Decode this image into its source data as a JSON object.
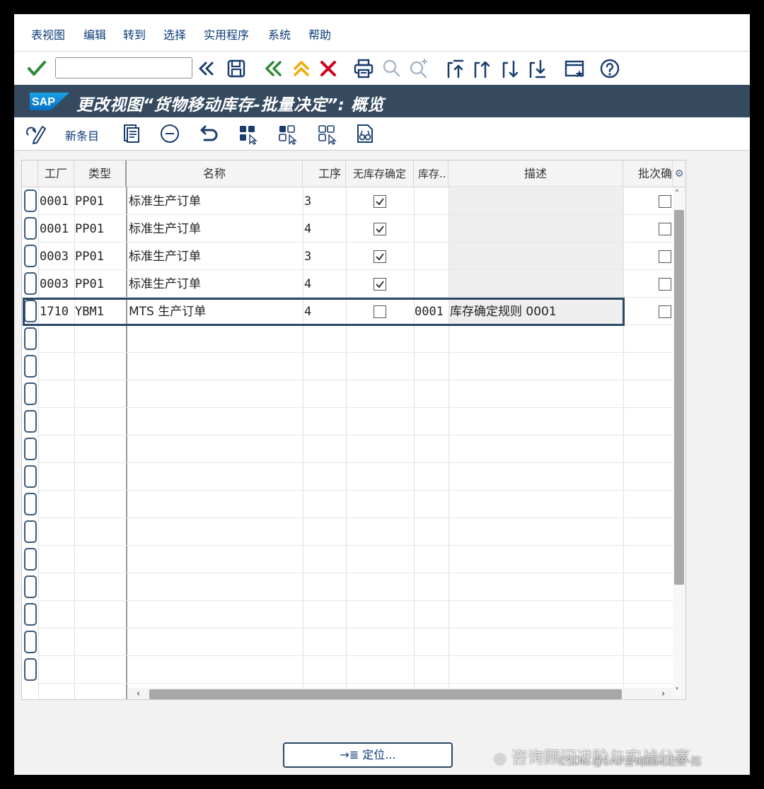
{
  "menu": [
    "表视图",
    "编辑",
    "转到",
    "选择",
    "实用程序",
    "系统",
    "帮助"
  ],
  "toolbar": {
    "command_value": "",
    "icons": [
      "enter-icon",
      "back-arrows-icon",
      "save-icon",
      "back-icon",
      "exit-icon",
      "cancel-icon",
      "print-icon",
      "find-icon",
      "find-next-icon",
      "first-page-icon",
      "previous-page-icon",
      "next-page-icon",
      "last-page-icon",
      "new-session-icon",
      "help-icon"
    ]
  },
  "title": {
    "logo": "SAP",
    "text": "更改视图“货物移动库存-批量决定”: 概览"
  },
  "app_toolbar": {
    "new_entry_label": "新条目",
    "icons": [
      "change-display-icon",
      "copy-icon",
      "delete-icon",
      "undo-icon",
      "select-all-icon",
      "select-block-icon",
      "deselect-all-icon",
      "print-preview-icon"
    ]
  },
  "table": {
    "columns": [
      "工厂",
      "类型",
      "名称",
      "工序",
      "无库存确定",
      "库存..",
      "描述",
      "批次确"
    ],
    "rows": [
      {
        "plant": "0001",
        "type": "PP01",
        "name": "标准生产订单",
        "step": "3",
        "no_stock": true,
        "stock": "",
        "desc": "",
        "batch": false
      },
      {
        "plant": "0001",
        "type": "PP01",
        "name": "标准生产订单",
        "step": "4",
        "no_stock": true,
        "stock": "",
        "desc": "",
        "batch": false
      },
      {
        "plant": "0003",
        "type": "PP01",
        "name": "标准生产订单",
        "step": "3",
        "no_stock": true,
        "stock": "",
        "desc": "",
        "batch": false
      },
      {
        "plant": "0003",
        "type": "PP01",
        "name": "标准生产订单",
        "step": "4",
        "no_stock": true,
        "stock": "",
        "desc": "",
        "batch": false
      },
      {
        "plant": "1710",
        "type": "YBM1",
        "name": "MTS 生产订单",
        "step": "4",
        "no_stock": false,
        "stock": "0001",
        "desc": "库存确定规则 0001",
        "batch": false
      }
    ],
    "empty_rows": 13,
    "selected_row": 5
  },
  "footer": {
    "position_button": "→≣ 定位..."
  },
  "watermark": {
    "line1": "咨询顾问进阶与实战分享",
    "line2": "CSDN @SAP咨询顾问进阶-陈"
  },
  "colors": {
    "title_bar": "#354a5f",
    "menu_text": "#0a3a78",
    "enter_green": "#2e8b3a",
    "cancel_red": "#d0021b",
    "nav_orange": "#f0ab00"
  }
}
